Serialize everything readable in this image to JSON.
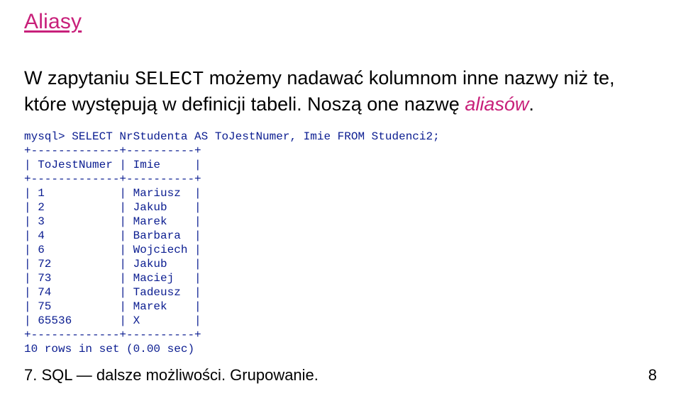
{
  "title": "Aliasy",
  "para": {
    "t1": "W zapytaniu ",
    "code": "SELECT",
    "t2": " możemy nadawać kolumnom inne nazwy niż te, które występują w definicji tabeli. Noszą one nazwę ",
    "emph": "aliasów",
    "t3": "."
  },
  "sql": {
    "query": "mysql> SELECT NrStudenta AS ToJestNumer, Imie FROM Studenci2;",
    "border": "+-------------+----------+",
    "header": "| ToJestNumer | Imie     |",
    "rows": [
      "| 1           | Mariusz  |",
      "| 2           | Jakub    |",
      "| 3           | Marek    |",
      "| 4           | Barbara  |",
      "| 6           | Wojciech |",
      "| 72          | Jakub    |",
      "| 73          | Maciej   |",
      "| 74          | Tadeusz  |",
      "| 75          | Marek    |",
      "| 65536       | X        |"
    ],
    "footer": "10 rows in set (0.00 sec)"
  },
  "pageFooter": {
    "left": "7. SQL — dalsze możliwości. Grupowanie.",
    "right": "8"
  }
}
